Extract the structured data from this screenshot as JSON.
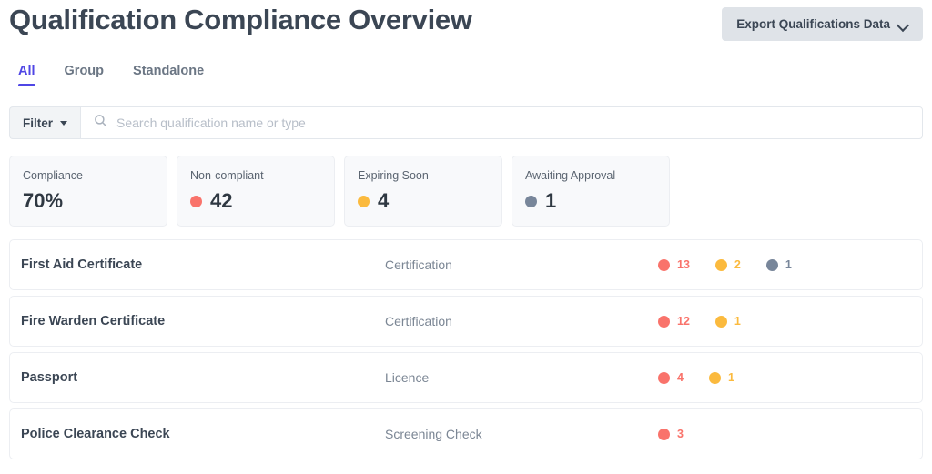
{
  "header": {
    "title": "Qualification Compliance Overview",
    "export_label": "Export Qualifications Data",
    "export_icon": "chevron-down-icon"
  },
  "tabs": [
    {
      "label": "All",
      "active": true
    },
    {
      "label": "Group",
      "active": false
    },
    {
      "label": "Standalone",
      "active": false
    }
  ],
  "filter": {
    "button_label": "Filter",
    "caret_icon": "caret-down-icon",
    "search_icon": "search-icon",
    "search_value": "",
    "search_placeholder": "Search qualification name or type"
  },
  "colors": {
    "non_compliant": "#f9736b",
    "expiring_soon": "#fbba3e",
    "awaiting_approval": "#78869a",
    "accent": "#4f46e5",
    "text_dark": "#3b4654",
    "text_muted": "#7b8694"
  },
  "stats": [
    {
      "label": "Compliance",
      "value": "70%",
      "dot": "none"
    },
    {
      "label": "Non-compliant",
      "value": "42",
      "dot": "non_compliant"
    },
    {
      "label": "Expiring Soon",
      "value": "4",
      "dot": "expiring_soon"
    },
    {
      "label": "Awaiting Approval",
      "value": "1",
      "dot": "awaiting_approval"
    }
  ],
  "rows": [
    {
      "name": "First Aid Certificate",
      "type": "Certification",
      "badges": [
        {
          "count": "13",
          "status": "non_compliant"
        },
        {
          "count": "2",
          "status": "expiring_soon"
        },
        {
          "count": "1",
          "status": "awaiting_approval"
        }
      ]
    },
    {
      "name": "Fire Warden Certificate",
      "type": "Certification",
      "badges": [
        {
          "count": "12",
          "status": "non_compliant"
        },
        {
          "count": "1",
          "status": "expiring_soon"
        }
      ]
    },
    {
      "name": "Passport",
      "type": "Licence",
      "badges": [
        {
          "count": "4",
          "status": "non_compliant"
        },
        {
          "count": "1",
          "status": "expiring_soon"
        }
      ]
    },
    {
      "name": "Police Clearance Check",
      "type": "Screening Check",
      "badges": [
        {
          "count": "3",
          "status": "non_compliant"
        }
      ]
    }
  ]
}
